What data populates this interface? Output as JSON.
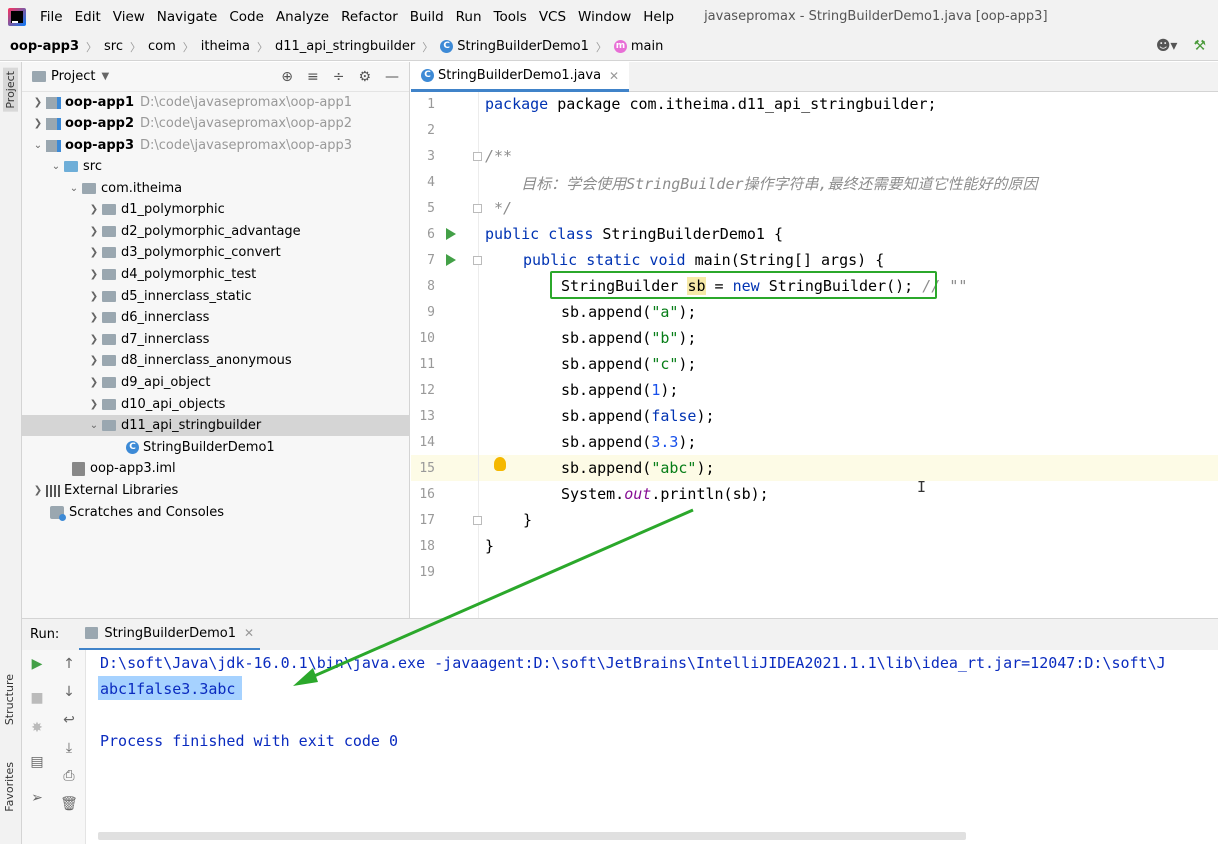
{
  "menubar": {
    "items": [
      "File",
      "Edit",
      "View",
      "Navigate",
      "Code",
      "Analyze",
      "Refactor",
      "Build",
      "Run",
      "Tools",
      "VCS",
      "Window",
      "Help"
    ],
    "window_title": "javasepromax - StringBuilderDemo1.java [oop-app3]"
  },
  "breadcrumb": {
    "items": [
      "oop-app3",
      "src",
      "com",
      "itheima",
      "d11_api_stringbuilder",
      "StringBuilderDemo1",
      "main"
    ]
  },
  "stripe": {
    "project": "Project",
    "structure": "Structure",
    "favorites": "Favorites"
  },
  "project_panel": {
    "title": "Project",
    "tree": [
      {
        "label": "oop-app1",
        "path": "D:\\code\\javasepromax\\oop-app1"
      },
      {
        "label": "oop-app2",
        "path": "D:\\code\\javasepromax\\oop-app2"
      },
      {
        "label": "oop-app3",
        "path": "D:\\code\\javasepromax\\oop-app3"
      },
      {
        "label": "src"
      },
      {
        "label": "com.itheima"
      },
      {
        "label": "d1_polymorphic"
      },
      {
        "label": "d2_polymorphic_advantage"
      },
      {
        "label": "d3_polymorphic_convert"
      },
      {
        "label": "d4_polymorphic_test"
      },
      {
        "label": "d5_innerclass_static"
      },
      {
        "label": "d6_innerclass"
      },
      {
        "label": "d7_innerclass"
      },
      {
        "label": "d8_innerclass_anonymous"
      },
      {
        "label": "d9_api_object"
      },
      {
        "label": "d10_api_objects"
      },
      {
        "label": "d11_api_stringbuilder"
      },
      {
        "label": "StringBuilderDemo1"
      },
      {
        "label": "oop-app3.iml"
      },
      {
        "label": "External Libraries"
      },
      {
        "label": "Scratches and Consoles"
      }
    ]
  },
  "editor": {
    "tab_label": "StringBuilderDemo1.java",
    "line_numbers": [
      "1",
      "2",
      "3",
      "4",
      "5",
      "6",
      "7",
      "8",
      "9",
      "10",
      "11",
      "12",
      "13",
      "14",
      "15",
      "16",
      "17",
      "18",
      "19"
    ],
    "code": {
      "l1": "package com.itheima.d11_api_stringbuilder;",
      "l3": "/**",
      "l4": "    目标：学会使用StringBuilder操作字符串,最终还需要知道它性能好的原因",
      "l5": " */",
      "l6_kw": "public class ",
      "l6_rest": "StringBuilderDemo1 {",
      "l7_kw": "public static void ",
      "l7_rest": "main(String[] args) {",
      "l8_a": "StringBuilder ",
      "l8_var": "sb",
      "l8_b": " = ",
      "l8_kw": "new ",
      "l8_c": "StringBuilder();",
      "l8_cmt": " // \"\"",
      "l9_a": "sb.append(",
      "l9_s": "\"a\"",
      "l10_s": "\"b\"",
      "l11_s": "\"c\"",
      "l12_n": "1",
      "l13_k": "false",
      "l14_n": "3.3",
      "l15_s": "\"abc\"",
      "close": ");",
      "l16_a": "System.",
      "l16_f": "out",
      "l16_b": ".println(sb);",
      "l17": "}",
      "l18": "}"
    }
  },
  "run_panel": {
    "label": "Run:",
    "tab_label": "StringBuilderDemo1",
    "cmd_line": "D:\\soft\\Java\\jdk-16.0.1\\bin\\java.exe -javaagent:D:\\soft\\JetBrains\\IntelliJIDEA2021.1.1\\lib\\idea_rt.jar=12047:D:\\soft\\J",
    "output": "abc1false3.3abc",
    "exit_msg": "Process finished with exit code 0"
  },
  "colors": {
    "keyword": "#0033b3",
    "string": "#067d17",
    "number": "#1750eb",
    "annotation": "#2ba82b",
    "console_text": "#0a2bbf"
  }
}
